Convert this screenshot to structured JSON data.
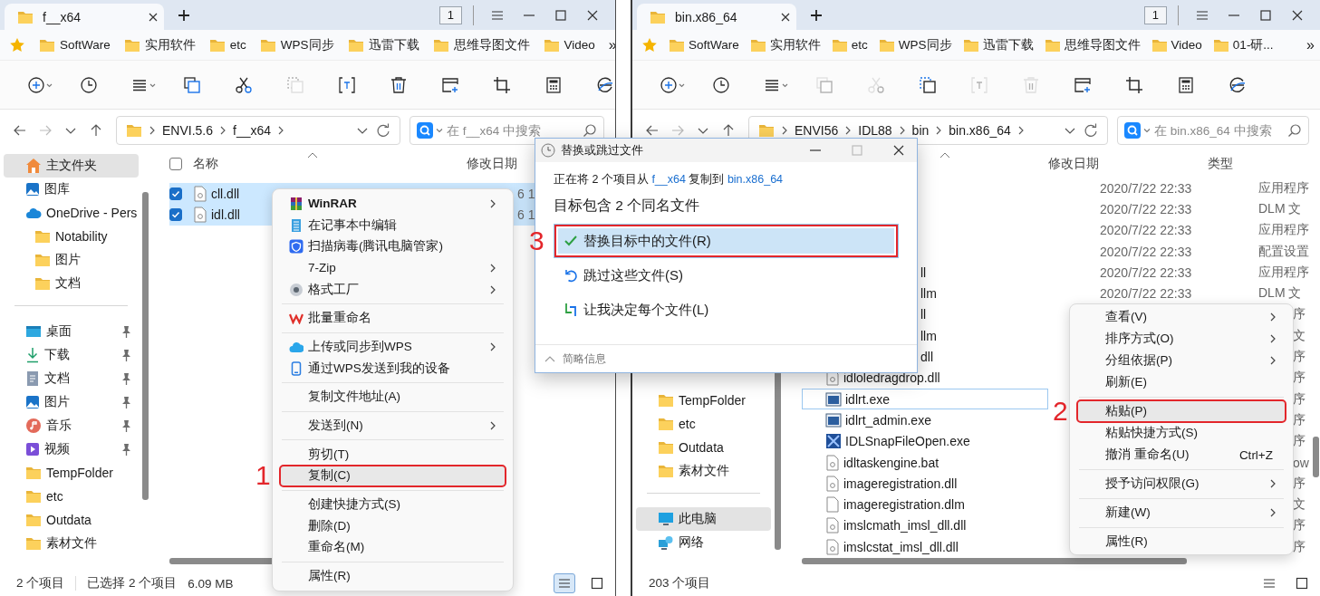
{
  "left_window": {
    "tab": {
      "title": "f__x64"
    },
    "tab_count": "1",
    "bookmarks": [
      "SoftWare",
      "实用软件",
      "etc",
      "WPS同步",
      "迅雷下载",
      "思维导图文件",
      "Video"
    ],
    "bookmarks_more": "»",
    "toolbar": [
      {
        "kind": "new",
        "disabled": false
      },
      {
        "kind": "recent",
        "disabled": false
      },
      {
        "kind": "view",
        "disabled": false
      },
      {
        "kind": "copy",
        "disabled": false
      },
      {
        "kind": "cut",
        "disabled": false
      },
      {
        "kind": "paste",
        "disabled": true
      },
      {
        "kind": "rename",
        "disabled": false
      },
      {
        "kind": "delete",
        "disabled": false
      },
      {
        "kind": "newtab",
        "disabled": false
      },
      {
        "kind": "crop",
        "disabled": false
      },
      {
        "kind": "calc",
        "disabled": false
      },
      {
        "kind": "edge",
        "disabled": false
      }
    ],
    "breadcrumb": [
      "ENVI.5.6",
      "f__x64"
    ],
    "search": {
      "placeholder": "在 f__x64 中搜索"
    },
    "sidebar": [
      [
        {
          "label": "主文件夹",
          "kind": "home",
          "selected": true
        },
        {
          "label": "图库",
          "kind": "gallery",
          "selected": false
        },
        {
          "label": "OneDrive - Pers",
          "kind": "cloud",
          "selected": false,
          "children": [
            {
              "label": "Notability",
              "kind": "folder",
              "selected": false
            },
            {
              "label": "图片",
              "kind": "folder",
              "selected": false
            },
            {
              "label": "文档",
              "kind": "folder",
              "selected": false
            }
          ]
        }
      ],
      [
        {
          "label": "桌面",
          "kind": "desktop",
          "selected": false,
          "pinned": true
        },
        {
          "label": "下载",
          "kind": "download",
          "selected": false,
          "pinned": true
        },
        {
          "label": "文档",
          "kind": "docs",
          "selected": false,
          "pinned": true
        },
        {
          "label": "图片",
          "kind": "gallery",
          "selected": false,
          "pinned": true
        },
        {
          "label": "音乐",
          "kind": "music",
          "selected": false,
          "pinned": true
        },
        {
          "label": "视频",
          "kind": "video",
          "selected": false,
          "pinned": true
        },
        {
          "label": "TempFolder",
          "kind": "folder",
          "selected": false,
          "pinned": false
        },
        {
          "label": "etc",
          "kind": "folder",
          "selected": false,
          "pinned": false
        },
        {
          "label": "Outdata",
          "kind": "folder",
          "selected": false,
          "pinned": false
        },
        {
          "label": "素材文件",
          "kind": "folder",
          "selected": false,
          "pinned": false
        }
      ]
    ],
    "columns": [
      {
        "kind": "name",
        "label": "名称"
      },
      {
        "kind": "date",
        "label": "修改日期"
      }
    ],
    "select_all": {
      "checked": false
    },
    "files": [
      {
        "name": "cll.dll",
        "kind": "dll",
        "selected": true,
        "date": "6 1"
      },
      {
        "name": "idl.dll",
        "kind": "dll",
        "selected": true,
        "date": "6 1"
      }
    ],
    "status": {
      "texts": [
        "2 个项目",
        "已选择 2 个项目",
        "6.09 MB"
      ],
      "views": [
        {
          "kind": "details",
          "selected": true
        },
        {
          "kind": "tiles",
          "selected": false
        }
      ]
    }
  },
  "right_window": {
    "tab": {
      "title": "bin.x86_64"
    },
    "tab_count": "1",
    "bookmarks": [
      "SoftWare",
      "实用软件",
      "etc",
      "WPS同步",
      "迅雷下载",
      "思维导图文件",
      "Video",
      "01-研..."
    ],
    "bookmarks_more": "»",
    "toolbar": [
      {
        "kind": "new",
        "disabled": false
      },
      {
        "kind": "recent",
        "disabled": false
      },
      {
        "kind": "view",
        "disabled": false
      },
      {
        "kind": "copy",
        "disabled": true
      },
      {
        "kind": "cut",
        "disabled": true
      },
      {
        "kind": "paste",
        "disabled": false
      },
      {
        "kind": "rename",
        "disabled": true
      },
      {
        "kind": "delete",
        "disabled": true
      },
      {
        "kind": "newtab",
        "disabled": false
      },
      {
        "kind": "crop",
        "disabled": false
      },
      {
        "kind": "calc",
        "disabled": false
      },
      {
        "kind": "edge",
        "disabled": false
      }
    ],
    "breadcrumb": [
      "ENVI56",
      "IDL88",
      "bin",
      "bin.x86_64"
    ],
    "search": {
      "placeholder": "在 bin.x86_64 中搜索"
    },
    "sidebar": [
      [
        {
          "label": "TempFolder",
          "kind": "folder",
          "selected": false,
          "pinned": false
        },
        {
          "label": "etc",
          "kind": "folder",
          "selected": false,
          "pinned": false
        },
        {
          "label": "Outdata",
          "kind": "folder",
          "selected": false,
          "pinned": false
        },
        {
          "label": "素材文件",
          "kind": "folder",
          "selected": false,
          "pinned": false
        }
      ],
      [
        {
          "label": "此电脑",
          "kind": "pc",
          "selected": true
        },
        {
          "label": "网络",
          "kind": "network",
          "selected": false
        }
      ]
    ],
    "columns": [
      {
        "kind": "date",
        "label": "修改日期"
      },
      {
        "kind": "type",
        "label": "类型"
      }
    ],
    "files": [
      {
        "date": "2020/7/22 22:33",
        "type": "应用程序",
        "hovered": false
      },
      {
        "date": "2020/7/22 22:33",
        "type": "DLM 文",
        "hovered": false
      },
      {
        "date": "2020/7/22 22:33",
        "type": "应用程序",
        "hovered": false
      },
      {
        "date": "2020/7/22 22:33",
        "type": "配置设置",
        "hovered": false
      },
      {
        "name": "ll",
        "date": "2020/7/22 22:33",
        "type": "应用程序",
        "hovered": false
      },
      {
        "name": "llm",
        "date": "2020/7/22 22:33",
        "type": "DLM 文",
        "hovered": false
      },
      {
        "name": "ll",
        "type": "序",
        "hovered": false
      },
      {
        "name": "llm",
        "type": "文",
        "hovered": false
      },
      {
        "name": "dll",
        "type": "序",
        "hovered": false
      },
      {
        "name": "idloledragdrop.dll",
        "kind": "dll",
        "type": "序",
        "hovered": false
      },
      {
        "name": "idlrt.exe",
        "kind": "exe",
        "type": "序",
        "hovered": true
      },
      {
        "name": "idlrt_admin.exe",
        "kind": "exe",
        "type": "序",
        "hovered": false
      },
      {
        "name": "IDLSnapFileOpen.exe",
        "kind": "snap",
        "type": "序",
        "hovered": false
      },
      {
        "name": "idltaskengine.bat",
        "kind": "dll",
        "type": "ow",
        "hovered": false
      },
      {
        "name": "imageregistration.dll",
        "kind": "dll",
        "type": "序",
        "hovered": false
      },
      {
        "name": "imageregistration.dlm",
        "kind": "blank",
        "type": "文",
        "hovered": false
      },
      {
        "name": "imslcmath_imsl_dll.dll",
        "kind": "dll",
        "type": "序",
        "hovered": false
      },
      {
        "name": "imslcstat_imsl_dll.dll",
        "kind": "dll",
        "type": "序",
        "hovered": false
      }
    ],
    "status": {
      "texts": [
        "203 个项目"
      ],
      "views": [
        {
          "kind": "details",
          "selected": false
        },
        {
          "kind": "tiles",
          "selected": false
        }
      ]
    }
  },
  "context_menus": [
    {
      "items": [
        {
          "kind": "winrar",
          "label": "WinRAR",
          "submenu": true,
          "bold": true,
          "highlighted": false,
          "marked": false
        },
        {
          "kind": "notepad",
          "label": "在记事本中编辑",
          "submenu": false,
          "highlighted": false,
          "marked": false
        },
        {
          "kind": "shield",
          "label": "扫描病毒(腾讯电脑管家)",
          "submenu": false,
          "highlighted": false,
          "marked": false
        },
        {
          "kind": "plain",
          "label": "7-Zip",
          "submenu": true,
          "highlighted": false,
          "marked": false
        },
        {
          "kind": "format",
          "label": "格式工厂",
          "submenu": true,
          "highlighted": false,
          "marked": false
        },
        {
          "kind": "separator"
        },
        {
          "kind": "wps",
          "label": "批量重命名",
          "submenu": false,
          "highlighted": false,
          "marked": false
        },
        {
          "kind": "separator"
        },
        {
          "kind": "wpscloud",
          "label": "上传或同步到WPS",
          "submenu": true,
          "highlighted": false,
          "marked": false
        },
        {
          "kind": "phone",
          "label": "通过WPS发送到我的设备",
          "submenu": false,
          "highlighted": false,
          "marked": false
        },
        {
          "kind": "separator"
        },
        {
          "kind": "plain",
          "label": "复制文件地址(A)",
          "submenu": false,
          "highlighted": false,
          "marked": false
        },
        {
          "kind": "separator"
        },
        {
          "kind": "plain",
          "label": "发送到(N)",
          "submenu": true,
          "highlighted": false,
          "marked": false
        },
        {
          "kind": "separator"
        },
        {
          "kind": "plain",
          "label": "剪切(T)",
          "submenu": false,
          "highlighted": false,
          "marked": false
        },
        {
          "kind": "plain",
          "label": "复制(C)",
          "submenu": false,
          "highlighted": true,
          "marked": true,
          "step": "1"
        },
        {
          "kind": "separator"
        },
        {
          "kind": "plain",
          "label": "创建快捷方式(S)",
          "submenu": false,
          "highlighted": false,
          "marked": false
        },
        {
          "kind": "plain",
          "label": "删除(D)",
          "submenu": false,
          "highlighted": false,
          "marked": false
        },
        {
          "kind": "plain",
          "label": "重命名(M)",
          "submenu": false,
          "highlighted": false,
          "marked": false
        },
        {
          "kind": "separator"
        },
        {
          "kind": "plain",
          "label": "属性(R)",
          "submenu": false,
          "highlighted": false,
          "marked": false
        }
      ]
    },
    {
      "items": [
        {
          "kind": "plain",
          "label": "查看(V)",
          "submenu": true,
          "highlighted": false,
          "marked": false
        },
        {
          "kind": "plain",
          "label": "排序方式(O)",
          "submenu": true,
          "highlighted": false,
          "marked": false
        },
        {
          "kind": "plain",
          "label": "分组依据(P)",
          "submenu": true,
          "highlighted": false,
          "marked": false
        },
        {
          "kind": "plain",
          "label": "刷新(E)",
          "submenu": false,
          "highlighted": false,
          "marked": false
        },
        {
          "kind": "separator"
        },
        {
          "kind": "plain",
          "label": "粘贴(P)",
          "submenu": false,
          "highlighted": true,
          "marked": true,
          "step": "2"
        },
        {
          "kind": "plain",
          "label": "粘贴快捷方式(S)",
          "submenu": false,
          "highlighted": false,
          "marked": false
        },
        {
          "kind": "plain",
          "label": "撤消 重命名(U)",
          "shortcut": "Ctrl+Z",
          "submenu": false,
          "highlighted": false,
          "marked": false
        },
        {
          "kind": "separator"
        },
        {
          "kind": "plain",
          "label": "授予访问权限(G)",
          "submenu": true,
          "highlighted": false,
          "marked": false
        },
        {
          "kind": "separator"
        },
        {
          "kind": "plain",
          "label": "新建(W)",
          "submenu": true,
          "highlighted": false,
          "marked": false
        },
        {
          "kind": "separator"
        },
        {
          "kind": "plain",
          "label": "属性(R)",
          "submenu": false,
          "highlighted": false,
          "marked": false
        }
      ]
    }
  ],
  "dialog": {
    "title": "替换或跳过文件",
    "summary": [
      {
        "kind": "text",
        "text": "正在将 2 个项目从"
      },
      {
        "kind": "link",
        "text": "f__x64"
      },
      {
        "kind": "text",
        "text": "复制到"
      },
      {
        "kind": "link",
        "text": "bin.x86_64"
      }
    ],
    "heading": "目标包含 2 个同名文件",
    "options": [
      {
        "label": "替换目标中的文件(R)",
        "kind": "check",
        "selected": true,
        "marked": true,
        "step": "3"
      },
      {
        "label": "跳过这些文件(S)",
        "kind": "undo",
        "selected": false,
        "marked": false
      },
      {
        "label": "让我决定每个文件(L)",
        "kind": "swap",
        "selected": false,
        "marked": false
      }
    ],
    "details": "简略信息"
  }
}
